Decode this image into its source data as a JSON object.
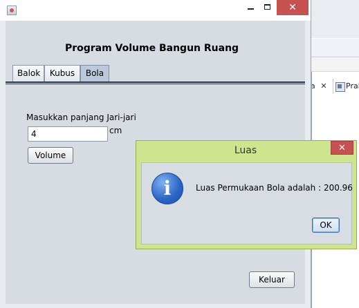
{
  "background_app": {
    "tab_fragment": "a",
    "tab_close_symbol": "✕",
    "tab_label": "Prak"
  },
  "window": {
    "controls": {
      "minimize": "",
      "maximize": "",
      "close": "✕"
    }
  },
  "header": {
    "title": "Program Volume Bangun Ruang"
  },
  "tabs": [
    {
      "label": "Balok",
      "selected": false
    },
    {
      "label": "Kubus",
      "selected": false
    },
    {
      "label": "Bola",
      "selected": true
    }
  ],
  "form": {
    "radius_label": "Masukkan panjang Jari-jari",
    "radius_value": "4",
    "unit": "cm",
    "volume_button": "Volume"
  },
  "footer": {
    "exit_button": "Keluar"
  },
  "dialog": {
    "title": "Luas",
    "close_symbol": "✕",
    "icon": "information-icon",
    "icon_glyph": "i",
    "message": "Luas Permukaan Bola adalah : 200.96",
    "ok_button": "OK"
  },
  "colors": {
    "dialog_frame": "#cfe48f",
    "close_button": "#c75050",
    "info_icon": "#2a64c4"
  }
}
